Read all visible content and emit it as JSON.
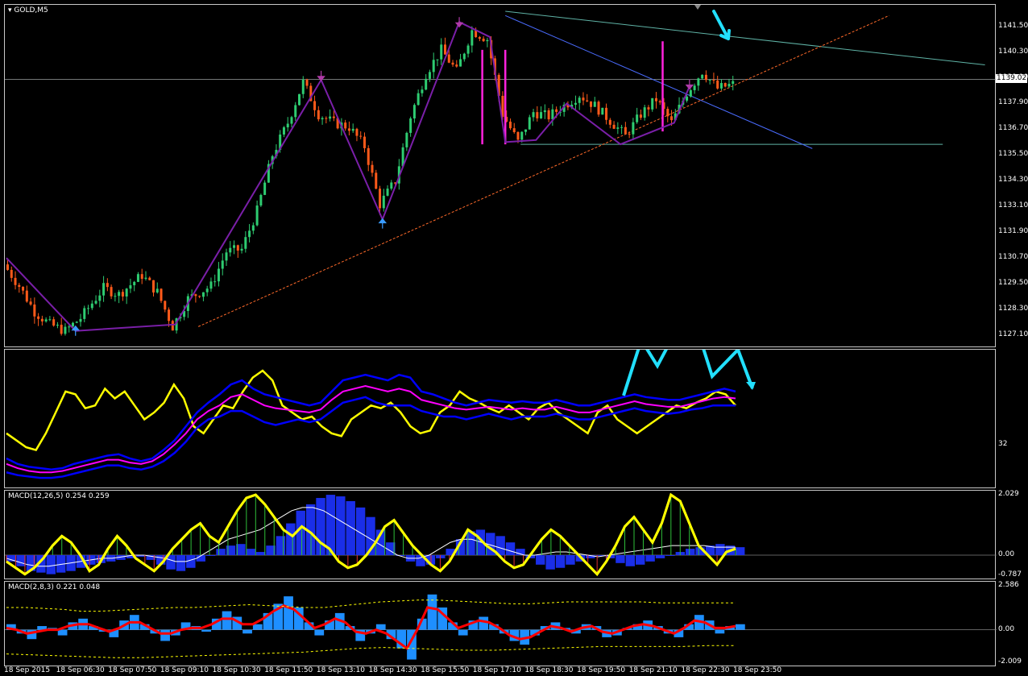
{
  "symbol": "GOLD,M5",
  "chart_data": [
    {
      "type": "candlestick",
      "title": "GOLD,M5",
      "ylim": [
        1126.5,
        1142.5
      ],
      "yticks": [
        "1141.50",
        "1140.30",
        "1139.10",
        "1137.90",
        "1136.70",
        "1135.50",
        "1134.30",
        "1133.10",
        "1131.90",
        "1130.70",
        "1129.50",
        "1128.30",
        "1127.10"
      ],
      "current_price": "1139.02",
      "xticks": [
        "18 Sep 2015",
        "18 Sep 06:30",
        "18 Sep 07:50",
        "18 Sep 09:10",
        "18 Sep 10:30",
        "18 Sep 11:50",
        "18 Sep 13:10",
        "18 Sep 14:30",
        "18 Sep 15:50",
        "18 Sep 17:10",
        "18 Sep 18:30",
        "18 Sep 19:50",
        "18 Sep 21:10",
        "18 Sep 22:30",
        "18 Sep 23:50"
      ],
      "price_path": [
        [
          0,
          1130.4
        ],
        [
          4,
          1129.4
        ],
        [
          8,
          1128.2
        ],
        [
          12,
          1127.6
        ],
        [
          16,
          1127.3
        ],
        [
          20,
          1127.9
        ],
        [
          26,
          1129.3
        ],
        [
          30,
          1129.0
        ],
        [
          36,
          1129.9
        ],
        [
          40,
          1129.1
        ],
        [
          44,
          1127.5
        ],
        [
          48,
          1128.8
        ],
        [
          54,
          1129.4
        ],
        [
          58,
          1131.0
        ],
        [
          62,
          1131.1
        ],
        [
          66,
          1132.9
        ],
        [
          70,
          1135.5
        ],
        [
          74,
          1137.0
        ],
        [
          78,
          1138.9
        ],
        [
          82,
          1137.4
        ],
        [
          86,
          1137.0
        ],
        [
          90,
          1136.8
        ],
        [
          94,
          1135.9
        ],
        [
          98,
          1133.2
        ],
        [
          102,
          1134.3
        ],
        [
          106,
          1137.3
        ],
        [
          110,
          1139.3
        ],
        [
          114,
          1140.4
        ],
        [
          118,
          1139.4
        ],
        [
          122,
          1141.3
        ],
        [
          126,
          1140.9
        ],
        [
          130,
          1137.4
        ],
        [
          134,
          1136.1
        ],
        [
          138,
          1137.5
        ],
        [
          142,
          1137.3
        ],
        [
          146,
          1137.8
        ],
        [
          150,
          1138.3
        ],
        [
          154,
          1137.8
        ],
        [
          158,
          1137.1
        ],
        [
          162,
          1136.4
        ],
        [
          166,
          1137.4
        ],
        [
          170,
          1138.1
        ],
        [
          174,
          1137.0
        ],
        [
          178,
          1138.4
        ],
        [
          182,
          1139.4
        ],
        [
          186,
          1138.6
        ],
        [
          190,
          1138.8
        ]
      ],
      "zigzag_points": [
        [
          0,
          1130.7
        ],
        [
          18,
          1127.3
        ],
        [
          44,
          1127.6
        ],
        [
          82,
          1139.0
        ],
        [
          98,
          1132.5
        ],
        [
          118,
          1141.7
        ],
        [
          126,
          1141.0
        ],
        [
          130,
          1136.1
        ],
        [
          138,
          1136.2
        ],
        [
          146,
          1137.9
        ],
        [
          160,
          1136.0
        ],
        [
          174,
          1137.0
        ],
        [
          178,
          1138.7
        ]
      ],
      "arrows": [
        {
          "dir": "up",
          "i": 18,
          "y": 1127.3
        },
        {
          "dir": "down",
          "i": 82,
          "y": 1139.2
        },
        {
          "dir": "up",
          "i": 98,
          "y": 1132.3
        },
        {
          "dir": "down",
          "i": 118,
          "y": 1141.7
        },
        {
          "dir": "down",
          "i": 178,
          "y": 1138.8
        }
      ],
      "spikes": [
        {
          "i": 124,
          "from": 1136.0,
          "to": 1140.4
        },
        {
          "i": 130,
          "from": 1136.0,
          "to": 1140.4
        },
        {
          "i": 171,
          "from": 1136.6,
          "to": 1140.8
        }
      ]
    },
    {
      "type": "line",
      "ylim": [
        0,
        100
      ],
      "yticks": [
        "32"
      ],
      "series": [
        {
          "role": "oscillator",
          "color": "#ffff00",
          "values": [
            40,
            35,
            30,
            28,
            40,
            55,
            70,
            68,
            58,
            60,
            72,
            65,
            70,
            60,
            50,
            55,
            62,
            75,
            65,
            45,
            40,
            50,
            60,
            58,
            70,
            80,
            85,
            78,
            60,
            55,
            50,
            52,
            45,
            40,
            38,
            50,
            55,
            60,
            58,
            62,
            55,
            45,
            40,
            42,
            55,
            60,
            70,
            65,
            62,
            58,
            55,
            60,
            55,
            50,
            58,
            62,
            55,
            50,
            45,
            40,
            55,
            60,
            50,
            45,
            40,
            45,
            50,
            55,
            60,
            58,
            62,
            65,
            70,
            68,
            60
          ]
        },
        {
          "role": "upper-band",
          "color": "#0000ff",
          "values": [
            22,
            18,
            16,
            15,
            14,
            15,
            18,
            20,
            22,
            24,
            25,
            22,
            20,
            22,
            28,
            35,
            45,
            55,
            62,
            68,
            75,
            78,
            72,
            68,
            66,
            64,
            62,
            60,
            62,
            70,
            78,
            80,
            82,
            80,
            78,
            82,
            80,
            70,
            68,
            65,
            62,
            60,
            62,
            64,
            63,
            62,
            63,
            62,
            62,
            64,
            62,
            60,
            60,
            62,
            64,
            66,
            68,
            66,
            65,
            64,
            64,
            66,
            68,
            70,
            72,
            70
          ]
        },
        {
          "role": "middle",
          "color": "#ff00ff",
          "values": [
            18,
            15,
            13,
            12,
            12,
            13,
            15,
            17,
            19,
            21,
            21,
            19,
            18,
            20,
            25,
            32,
            40,
            50,
            56,
            60,
            66,
            68,
            64,
            60,
            58,
            57,
            56,
            55,
            57,
            64,
            70,
            72,
            74,
            72,
            70,
            72,
            70,
            64,
            62,
            60,
            58,
            57,
            58,
            59,
            58,
            57,
            58,
            57,
            57,
            59,
            57,
            55,
            55,
            57,
            59,
            61,
            63,
            61,
            60,
            59,
            59,
            61,
            63,
            65,
            66,
            65
          ]
        },
        {
          "role": "lower-band",
          "color": "#0000ff",
          "values": [
            12,
            10,
            9,
            8,
            8,
            9,
            11,
            13,
            15,
            17,
            17,
            15,
            14,
            16,
            20,
            26,
            34,
            44,
            50,
            52,
            56,
            56,
            52,
            48,
            46,
            48,
            50,
            48,
            50,
            56,
            62,
            64,
            66,
            62,
            60,
            60,
            60,
            56,
            54,
            52,
            52,
            50,
            52,
            54,
            52,
            50,
            52,
            52,
            52,
            54,
            52,
            50,
            50,
            52,
            54,
            56,
            58,
            56,
            55,
            54,
            55,
            57,
            58,
            60,
            60,
            60
          ]
        }
      ]
    },
    {
      "type": "bar",
      "title": "MACD(12,26,5) 0.254 0.259",
      "ylim": [
        -0.787,
        2.029
      ],
      "yticks": [
        "2.029",
        "0.00",
        "-0.787"
      ],
      "series": [
        {
          "role": "histogram",
          "color": "#0000ff",
          "values": [
            -0.2,
            -0.35,
            -0.5,
            -0.55,
            -0.6,
            -0.55,
            -0.5,
            -0.4,
            -0.3,
            -0.25,
            -0.2,
            -0.15,
            -0.1,
            -0.05,
            -0.15,
            -0.3,
            -0.45,
            -0.5,
            -0.4,
            -0.2,
            0.0,
            0.2,
            0.3,
            0.35,
            0.2,
            0.1,
            0.3,
            0.6,
            1.0,
            1.4,
            1.6,
            1.8,
            1.9,
            1.85,
            1.7,
            1.5,
            1.2,
            0.8,
            0.4,
            0.0,
            -0.2,
            -0.35,
            -0.3,
            -0.1,
            0.2,
            0.5,
            0.75,
            0.8,
            0.7,
            0.6,
            0.4,
            0.2,
            -0.1,
            -0.3,
            -0.45,
            -0.4,
            -0.3,
            -0.2,
            -0.1,
            0.0,
            -0.1,
            -0.25,
            -0.35,
            -0.3,
            -0.2,
            -0.1,
            0.0,
            0.1,
            0.2,
            0.25,
            0.3,
            0.35,
            0.3,
            0.25
          ]
        },
        {
          "role": "fast-line",
          "color": "#ffff00",
          "values": [
            -0.2,
            -0.4,
            -0.6,
            -0.4,
            -0.1,
            0.3,
            0.6,
            0.4,
            0.0,
            -0.5,
            -0.3,
            0.2,
            0.6,
            0.3,
            -0.1,
            -0.3,
            -0.5,
            -0.2,
            0.2,
            0.5,
            0.8,
            1.0,
            0.6,
            0.4,
            0.9,
            1.4,
            1.8,
            1.9,
            1.6,
            1.2,
            0.8,
            0.6,
            0.9,
            0.7,
            0.4,
            0.2,
            -0.2,
            -0.4,
            -0.3,
            0.0,
            0.4,
            0.9,
            1.1,
            0.7,
            0.3,
            0.0,
            -0.3,
            -0.5,
            -0.2,
            0.3,
            0.8,
            0.6,
            0.3,
            0.1,
            -0.2,
            -0.4,
            -0.3,
            0.1,
            0.5,
            0.8,
            0.6,
            0.3,
            0.0,
            -0.3,
            -0.6,
            -0.2,
            0.3,
            0.9,
            1.2,
            0.8,
            0.4,
            1.0,
            1.9,
            1.7,
            1.0,
            0.3,
            0.0,
            -0.3,
            0.1,
            0.2
          ]
        },
        {
          "role": "signal-line",
          "color": "#ffffff",
          "values": [
            -0.1,
            -0.2,
            -0.3,
            -0.35,
            -0.35,
            -0.3,
            -0.25,
            -0.2,
            -0.15,
            -0.1,
            -0.1,
            -0.05,
            0.0,
            0.0,
            -0.05,
            -0.1,
            -0.2,
            -0.2,
            -0.1,
            0.1,
            0.3,
            0.5,
            0.6,
            0.7,
            0.8,
            1.0,
            1.2,
            1.4,
            1.5,
            1.5,
            1.4,
            1.2,
            1.0,
            0.8,
            0.6,
            0.4,
            0.2,
            0.0,
            -0.1,
            -0.1,
            0.0,
            0.2,
            0.4,
            0.5,
            0.5,
            0.4,
            0.3,
            0.2,
            0.1,
            0.0,
            0.0,
            0.05,
            0.1,
            0.1,
            0.05,
            0.0,
            -0.05,
            0.0,
            0.05,
            0.1,
            0.15,
            0.2,
            0.25,
            0.3,
            0.3,
            0.3,
            0.3,
            0.25,
            0.25,
            0.25
          ]
        }
      ]
    },
    {
      "type": "bar",
      "title": "MACD(2,8,3) 0.221 0.048",
      "ylim": [
        -2.009,
        2.586
      ],
      "yticks": [
        "2.586",
        "0.00",
        "-2.009"
      ],
      "series": [
        {
          "role": "histogram",
          "color": "#1e90ff",
          "values": [
            0.3,
            -0.2,
            -0.5,
            0.2,
            0.1,
            -0.3,
            0.4,
            0.6,
            0.2,
            -0.1,
            -0.4,
            0.5,
            0.8,
            0.3,
            -0.2,
            -0.6,
            -0.3,
            0.4,
            0.2,
            -0.1,
            0.6,
            1.0,
            0.7,
            -0.2,
            0.3,
            0.9,
            1.4,
            1.8,
            1.2,
            0.4,
            -0.3,
            0.5,
            0.9,
            0.2,
            -0.6,
            -0.2,
            0.3,
            -0.5,
            -1.0,
            -1.6,
            0.6,
            1.9,
            1.2,
            0.4,
            -0.3,
            0.5,
            0.7,
            0.3,
            -0.2,
            -0.6,
            -0.8,
            -0.3,
            0.2,
            0.4,
            0.1,
            -0.2,
            0.3,
            0.2,
            -0.4,
            -0.3,
            0.1,
            0.3,
            0.5,
            0.2,
            -0.2,
            -0.4,
            0.3,
            0.8,
            0.5,
            -0.2,
            0.2,
            0.3
          ]
        },
        {
          "role": "signal",
          "color": "#ff0000",
          "values": [
            0.1,
            0.0,
            -0.2,
            -0.1,
            0.0,
            0.0,
            0.2,
            0.3,
            0.3,
            0.1,
            -0.1,
            0.1,
            0.4,
            0.4,
            0.1,
            -0.2,
            -0.2,
            0.0,
            0.1,
            0.1,
            0.3,
            0.6,
            0.6,
            0.3,
            0.3,
            0.6,
            1.0,
            1.3,
            1.1,
            0.6,
            0.1,
            0.3,
            0.6,
            0.4,
            -0.1,
            -0.2,
            0.0,
            -0.2,
            -0.6,
            -1.0,
            0.0,
            1.2,
            1.1,
            0.6,
            0.1,
            0.3,
            0.5,
            0.4,
            0.1,
            -0.3,
            -0.5,
            -0.4,
            -0.1,
            0.2,
            0.1,
            -0.1,
            0.1,
            0.2,
            -0.1,
            -0.2,
            0.0,
            0.2,
            0.3,
            0.2,
            0.0,
            -0.2,
            0.1,
            0.5,
            0.4,
            0.1,
            0.1,
            0.2
          ]
        },
        {
          "role": "envelope-upper",
          "color": "#ffff00",
          "values": [
            1.2,
            1.2,
            1.15,
            1.1,
            1.0,
            1.0,
            1.05,
            1.1,
            1.15,
            1.2,
            1.2,
            1.25,
            1.3,
            1.35,
            1.3,
            1.25,
            1.2,
            1.2,
            1.3,
            1.4,
            1.5,
            1.55,
            1.6,
            1.6,
            1.55,
            1.5,
            1.45,
            1.4,
            1.4,
            1.45,
            1.5,
            1.5,
            1.5,
            1.5,
            1.5,
            1.45,
            1.45,
            1.45,
            1.45,
            1.45
          ]
        },
        {
          "role": "envelope-lower",
          "color": "#ffff00",
          "values": [
            -1.3,
            -1.35,
            -1.4,
            -1.45,
            -1.5,
            -1.5,
            -1.45,
            -1.4,
            -1.35,
            -1.3,
            -1.25,
            -1.2,
            -1.1,
            -1.0,
            -0.95,
            -1.0,
            -1.05,
            -1.1,
            -1.1,
            -1.05,
            -1.0,
            -0.95,
            -0.9,
            -0.9,
            -0.9,
            -0.9,
            -0.85,
            -0.85
          ]
        }
      ]
    }
  ]
}
